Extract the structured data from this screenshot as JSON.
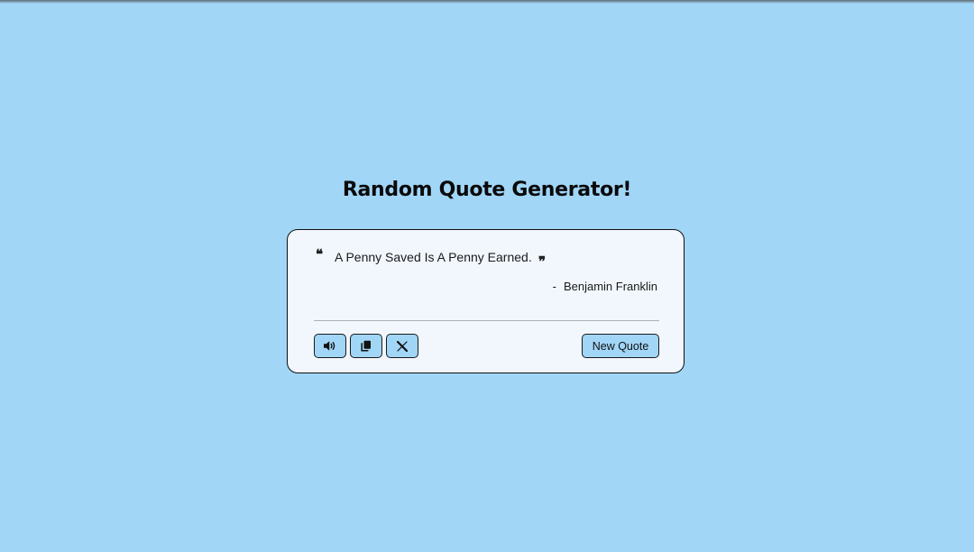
{
  "page": {
    "title": "Random Quote Generator!",
    "background_color": "#a1d6f7"
  },
  "quote_card": {
    "open_quote_mark": "❝",
    "text": "A Penny Saved Is A Penny Earned.",
    "close_quote_mark": "❞",
    "author_dash": "-",
    "author": "Benjamin Franklin",
    "background_color": "#f1f7fd"
  },
  "actions": {
    "speech_icon": "speaker-icon",
    "copy_icon": "copy-icon",
    "twitter_icon": "x-logo-icon",
    "new_quote_label": "New Quote",
    "button_color": "#a1d6f7"
  }
}
